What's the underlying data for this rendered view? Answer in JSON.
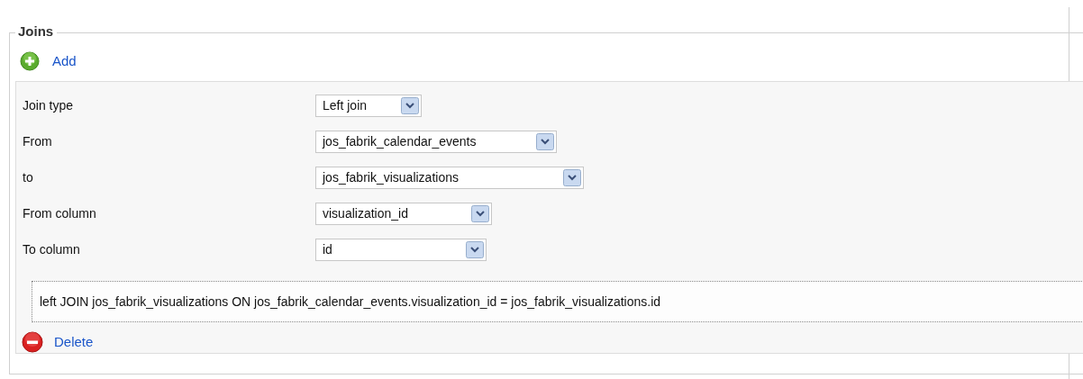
{
  "section": {
    "title": "Joins"
  },
  "add_link": {
    "label": "Add"
  },
  "join": {
    "fields": [
      {
        "label": "Join type",
        "value": "Left join"
      },
      {
        "label": "From",
        "value": "jos_fabrik_calendar_events"
      },
      {
        "label": "to",
        "value": "jos_fabrik_visualizations"
      },
      {
        "label": "From column",
        "value": "visualization_id"
      },
      {
        "label": "To column",
        "value": "id"
      }
    ],
    "sql": "left JOIN jos_fabrik_visualizations ON jos_fabrik_calendar_events.visualization_id = jos_fabrik_visualizations.id",
    "delete_link": {
      "label": "Delete"
    }
  }
}
